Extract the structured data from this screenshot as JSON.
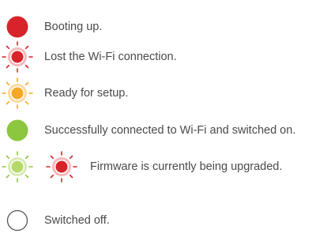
{
  "colors": {
    "red": "#d8232a",
    "orange": "#f7a823",
    "green": "#8dc63f",
    "light_green": "#b5d96b",
    "outline": "#555555",
    "text": "#4a4a4a"
  },
  "rows": [
    {
      "label": "Booting up.",
      "icons": [
        "red-solid-led-icon"
      ]
    },
    {
      "label": "Lost the Wi-Fi connection.",
      "icons": [
        "red-blinking-led-icon"
      ]
    },
    {
      "label": "Ready for setup.",
      "icons": [
        "orange-blinking-led-icon"
      ]
    },
    {
      "label": "Successfully connected to Wi-Fi and switched on.",
      "icons": [
        "green-solid-led-icon"
      ]
    },
    {
      "label": "Firmware is currently being upgraded.",
      "icons": [
        "green-blinking-led-icon",
        "red-blinking-led-icon"
      ]
    },
    {
      "label": "Switched off.",
      "icons": [
        "led-off-icon"
      ]
    }
  ]
}
